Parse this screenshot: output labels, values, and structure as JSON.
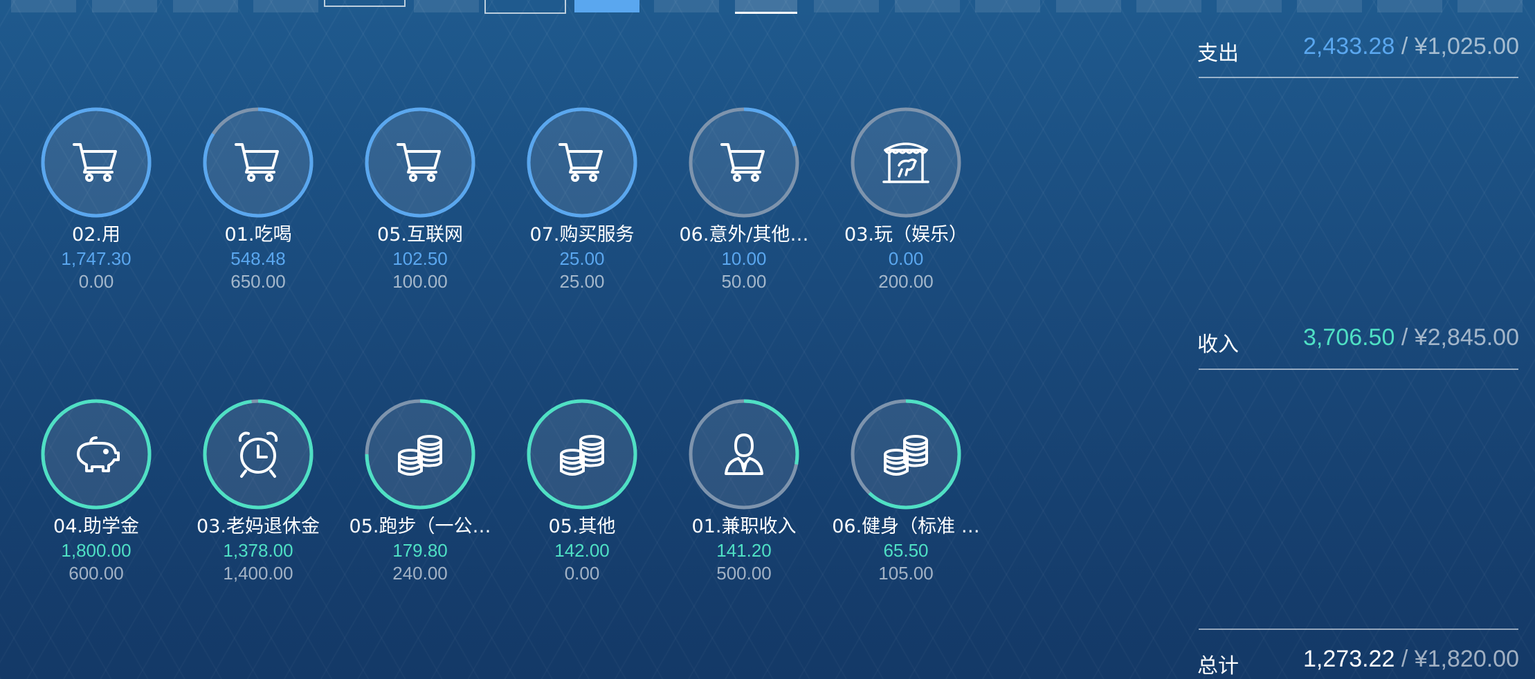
{
  "colors": {
    "expense_accent": "#5aa7ef",
    "income_accent": "#4fe0c4",
    "ring_track": "#7e94ad",
    "muted_text": "#a9b9cc"
  },
  "summary": {
    "expense": {
      "label": "支出",
      "amount": "2,433.28",
      "separator": "/",
      "budget": "¥1,025.00"
    },
    "income": {
      "label": "收入",
      "amount": "3,706.50",
      "separator": "/",
      "budget": "¥2,845.00"
    },
    "total": {
      "label": "总计",
      "amount": "1,273.22",
      "separator": "/",
      "budget": "¥1,820.00"
    }
  },
  "expense_items": [
    {
      "label": "02.用",
      "amount": "1,747.30",
      "budget": "0.00",
      "icon": "cart-icon",
      "progress": 1.0
    },
    {
      "label": "01.吃喝",
      "amount": "548.48",
      "budget": "650.00",
      "icon": "cart-icon",
      "progress": 0.84
    },
    {
      "label": "05.互联网",
      "amount": "102.50",
      "budget": "100.00",
      "icon": "cart-icon",
      "progress": 1.0
    },
    {
      "label": "07.购买服务",
      "amount": "25.00",
      "budget": "25.00",
      "icon": "cart-icon",
      "progress": 1.0
    },
    {
      "label": "06.意外/其他…",
      "amount": "10.00",
      "budget": "50.00",
      "icon": "cart-icon",
      "progress": 0.2
    },
    {
      "label": "03.玩（娱乐）",
      "amount": "0.00",
      "budget": "200.00",
      "icon": "carousel-icon",
      "progress": 0.0
    }
  ],
  "income_items": [
    {
      "label": "04.助学金",
      "amount": "1,800.00",
      "budget": "600.00",
      "icon": "piggy-bank-icon",
      "progress": 1.0
    },
    {
      "label": "03.老妈退休金",
      "amount": "1,378.00",
      "budget": "1,400.00",
      "icon": "alarm-clock-icon",
      "progress": 0.98
    },
    {
      "label": "05.跑步（一公…",
      "amount": "179.80",
      "budget": "240.00",
      "icon": "coins-icon",
      "progress": 0.75
    },
    {
      "label": "05.其他",
      "amount": "142.00",
      "budget": "0.00",
      "icon": "coins-icon",
      "progress": 1.0
    },
    {
      "label": "01.兼职收入",
      "amount": "141.20",
      "budget": "500.00",
      "icon": "person-icon",
      "progress": 0.28
    },
    {
      "label": "06.健身（标准 …",
      "amount": "65.50",
      "budget": "105.00",
      "icon": "coins-icon",
      "progress": 0.62
    }
  ]
}
